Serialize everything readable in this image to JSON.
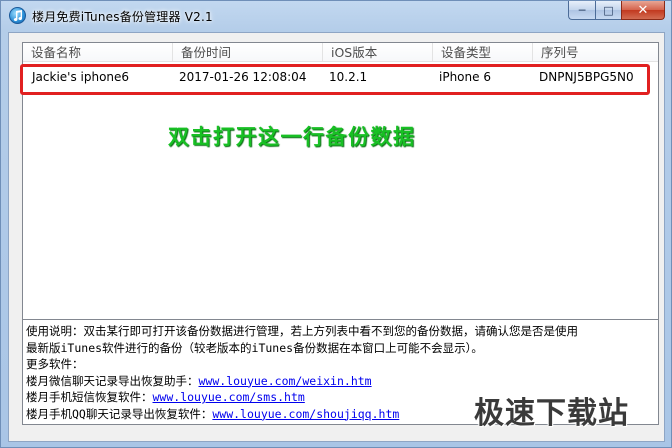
{
  "window": {
    "title": "楼月免费iTunes备份管理器 V2.1",
    "controls": {
      "minimize": "─",
      "maximize": "□",
      "close": "✕"
    },
    "icons": {
      "app": "itunes-music-note-icon"
    }
  },
  "list": {
    "columns": [
      "设备名称",
      "备份时间",
      "iOS版本",
      "设备类型",
      "序列号"
    ],
    "rows": [
      {
        "device_name": "Jackie's iphone6",
        "backup_time": "2017-01-26 12:08:04",
        "ios_version": "10.2.1",
        "device_type": "iPhone 6",
        "serial": "DNPNJ5BPG5N0"
      }
    ]
  },
  "annotation": "双击打开这一行备份数据",
  "help": {
    "line1": "使用说明：双击某行即可打开该备份数据进行管理，若上方列表中看不到您的备份数据，请确认您是否是使用",
    "line2": "最新版iTunes软件进行的备份（较老版本的iTunes备份数据在本窗口上可能不会显示）。",
    "line3": "更多软件：",
    "links": [
      {
        "label": "楼月微信聊天记录导出恢复助手：",
        "url": "www.louyue.com/weixin.htm"
      },
      {
        "label": "楼月手机短信恢复软件：",
        "url": "www.louyue.com/sms.htm"
      },
      {
        "label": "楼月手机QQ聊天记录导出恢复软件：",
        "url": "www.louyue.com/shoujiqq.htm"
      }
    ]
  },
  "watermark": "极速下载站",
  "colors": {
    "highlight": "#e12020",
    "annotation": "#18c024",
    "link": "#0000ee"
  }
}
